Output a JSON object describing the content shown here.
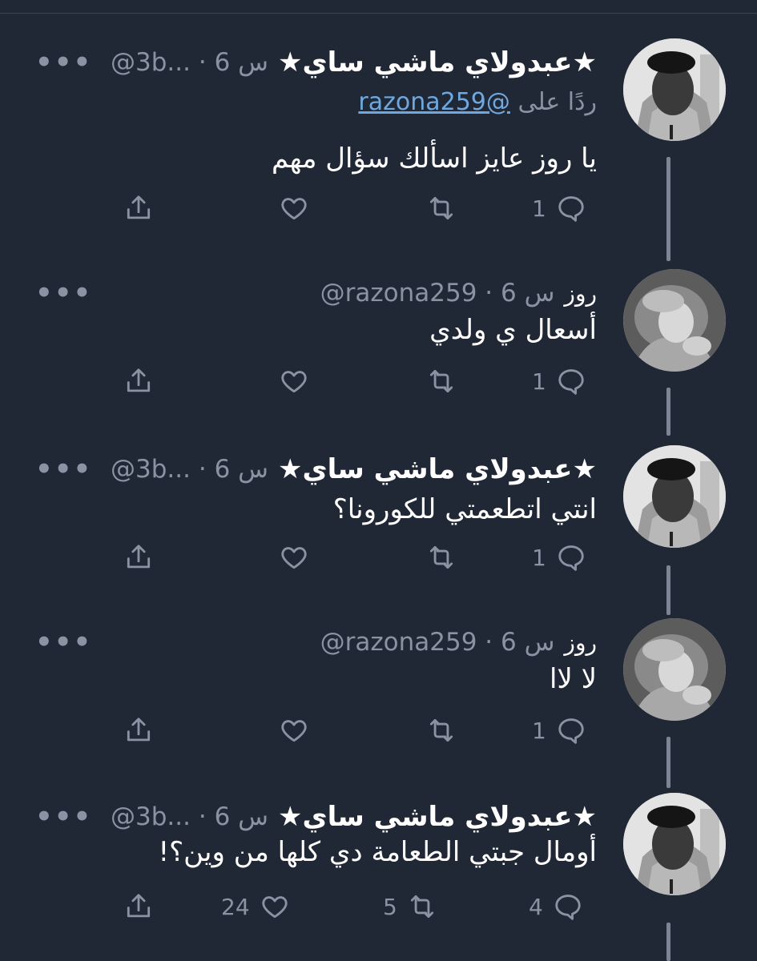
{
  "tweets": [
    {
      "name": "★عبدولاي ماشي ساي★",
      "handle": "@3b...",
      "time": "6 س",
      "reply_prefix": "ردًا على",
      "reply_handle": "@razona259",
      "text": "يا روز عايز اسألك سؤال مهم",
      "replies": "1",
      "retweets": "",
      "likes": "",
      "avatar": "person-hoodie"
    },
    {
      "name": "روز",
      "handle": "@razona259",
      "time": "6 س",
      "text": "أسعال ي ولدي",
      "replies": "1",
      "retweets": "",
      "likes": "",
      "avatar": "statue"
    },
    {
      "name": "★عبدولاي ماشي ساي★",
      "handle": "@3b...",
      "time": "6 س",
      "text": "انتي اتطعمتي للكورونا؟",
      "replies": "1",
      "retweets": "",
      "likes": "",
      "avatar": "person-hoodie"
    },
    {
      "name": "روز",
      "handle": "@razona259",
      "time": "6 س",
      "text": "لا لاا",
      "replies": "1",
      "retweets": "",
      "likes": "",
      "avatar": "statue"
    },
    {
      "name": "★عبدولاي ماشي ساي★",
      "handle": "@3b...",
      "time": "6 س",
      "text": "أومال جبتي الطعامة دي كلها من وين؟!",
      "replies": "4",
      "retweets": "5",
      "likes": "24",
      "avatar": "person-hoodie"
    }
  ],
  "more_label": "•••",
  "separator": "·",
  "icons": [
    "reply-icon",
    "retweet-icon",
    "like-icon",
    "share-icon",
    "more-icon"
  ]
}
